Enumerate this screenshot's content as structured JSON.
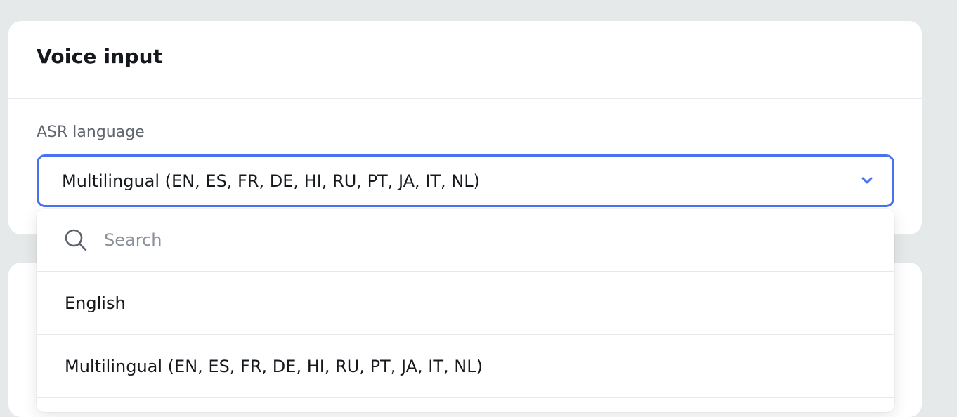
{
  "card": {
    "title": "Voice input",
    "field_label": "ASR language",
    "selected_value": "Multilingual (EN, ES, FR, DE, HI, RU, PT, JA, IT, NL)"
  },
  "dropdown": {
    "search_placeholder": "Search",
    "options": [
      {
        "label": "English"
      },
      {
        "label": "Multilingual (EN, ES, FR, DE, HI, RU, PT, JA, IT, NL)"
      }
    ]
  },
  "icons": {
    "search": "search-icon",
    "chevron": "chevron-down-icon"
  },
  "colors": {
    "accent": "#4a72f0",
    "background": "#e6e9ea",
    "card": "#ffffff",
    "label_text": "#5f6670",
    "placeholder_text": "#8a9099"
  }
}
